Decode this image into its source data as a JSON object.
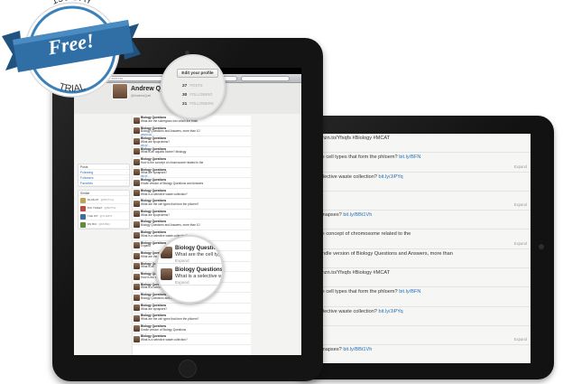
{
  "badge": {
    "top_text": "150 DAY",
    "main_text": "Free!",
    "bottom_text": "TRIAL",
    "colors": {
      "ribbon": "#2f6fa6",
      "ring": "#3b80b8"
    }
  },
  "front": {
    "status_time": "6:04 PM",
    "address_placeholder": "Go to this address",
    "profile": {
      "name": "Andrew Quel",
      "handle": "@AndrewQuel"
    },
    "edit_profile_label": "Edit your profile",
    "stats": [
      {
        "value": "27",
        "label": "POSTS"
      },
      {
        "value": "30",
        "label": "FOLLOWING"
      },
      {
        "value": "21",
        "label": "FOLLOWERS"
      }
    ],
    "sidebar_nav": [
      {
        "label": "Posts"
      },
      {
        "label": "Following"
      },
      {
        "label": "Followers"
      },
      {
        "label": "Favorites"
      }
    ],
    "sidebar_section": "Similar",
    "sidebar_users": [
      {
        "name": "BLAB-RT",
        "meta": "@BIOTCH"
      },
      {
        "name": "BIO TWEET",
        "meta": "@BIOTW"
      },
      {
        "name": "THE INT",
        "meta": "@THEINT"
      },
      {
        "name": "RN BIO",
        "meta": "@RNBIO"
      }
    ],
    "feed": [
      {
        "name": "Biology Questions",
        "text": "What are the subregions into which the brain",
        "link": ""
      },
      {
        "name": "Biology Questions",
        "text": "Biology Questions and Answers, more than 10",
        "link": "amzn.to/..."
      },
      {
        "name": "Biology Questions",
        "text": "What are lipoproteins?",
        "link": "bit.ly/..."
      },
      {
        "name": "Biology Questions",
        "text": "What is an aquatic biome? #biology",
        "link": ""
      },
      {
        "name": "Biology Questions",
        "text": "How is the concept of chromosome related to the",
        "link": ""
      },
      {
        "name": "Biology Questions",
        "text": "What are synapses?",
        "link": "bit.ly/..."
      },
      {
        "name": "Biology Questions",
        "text": "Kindle version of Biology Questions and Answers",
        "link": ""
      },
      {
        "name": "Biology Questions",
        "text": "What is a selective waste collection?",
        "link": ""
      },
      {
        "name": "Biology Questions",
        "text": "What are the cell types that form the phloem?",
        "link": ""
      },
      {
        "name": "Biology Questions",
        "text": "What are lipoproteins?",
        "link": ""
      },
      {
        "name": "Biology Questions",
        "text": "Biology Questions and Answers, more than 10",
        "link": ""
      },
      {
        "name": "Biology Questions",
        "text": "What is a selective waste collection?",
        "link": ""
      },
      {
        "name": "Biology Questions",
        "text": "Expand",
        "link": ""
      },
      {
        "name": "Biology Questions",
        "text": "What are the cell types that form the phloem?",
        "link": ""
      },
      {
        "name": "Biology Questions",
        "text": "What is an aquatic biome?",
        "link": ""
      },
      {
        "name": "Biology Questions",
        "text": "How is the concept of chromosome related to",
        "link": ""
      },
      {
        "name": "Biology Questions",
        "text": "What is a selective waste collection?",
        "link": ""
      },
      {
        "name": "Biology Questions",
        "text": "Biology Questions and Answers, more than 10",
        "link": ""
      },
      {
        "name": "Biology Questions",
        "text": "What are synapses?",
        "link": ""
      },
      {
        "name": "Biology Questions",
        "text": "What are the cell types that form the phloem?",
        "link": ""
      },
      {
        "name": "Biology Questions",
        "text": "Kindle version of Biology Questions",
        "link": ""
      },
      {
        "name": "Biology Questions",
        "text": "What is a selective waste collection?",
        "link": ""
      }
    ],
    "magnified_tweets": [
      {
        "name": "Biology Questio",
        "text": "What are the cell typ",
        "action": "Expand"
      },
      {
        "name": "Biology Questions",
        "text": "What is a selective was",
        "action": "Expand"
      }
    ]
  },
  "back": {
    "tweets": [
      {
        "text": "amzn.to/Yfxqfs #Biology #MCAT",
        "link": "",
        "action": ""
      },
      {
        "text": "the cell types that form the phloem?",
        "link": "bit.ly/BFN",
        "action": "Expand"
      },
      {
        "text": "selective waste collection?",
        "link": "bit.ly/JiPYq",
        "action": ""
      },
      {
        "text": "",
        "link": "",
        "action": "Expand"
      },
      {
        "text": "synapses?",
        "link": "bit.ly/BBt1Vh",
        "action": ""
      },
      {
        "text": "the concept of chromosome related to the",
        "link": "",
        "action": "Expand"
      },
      {
        "text": "Kindle version of Biology Questions and Answers, more than",
        "link": "",
        "action": ""
      },
      {
        "text": "amzn.to/Yfxqfs #Biology #MCAT",
        "link": "",
        "action": ""
      },
      {
        "text": "the cell types that form the phloem?",
        "link": "bit.ly/BFN",
        "action": ""
      },
      {
        "text": "selective waste collection?",
        "link": "bit.ly/JiPYq",
        "action": ""
      },
      {
        "text": "",
        "link": "",
        "action": "Expand"
      },
      {
        "text": "synapses?",
        "link": "bit.ly/BBt1Vh",
        "action": ""
      },
      {
        "text": "Questions and Answers is",
        "link": "bit.ly/HiKhTsA • Top stories",
        "action": ""
      },
      {
        "text": "@AlfreDODonnel /Jackson",
        "link": "",
        "action": ""
      }
    ]
  }
}
